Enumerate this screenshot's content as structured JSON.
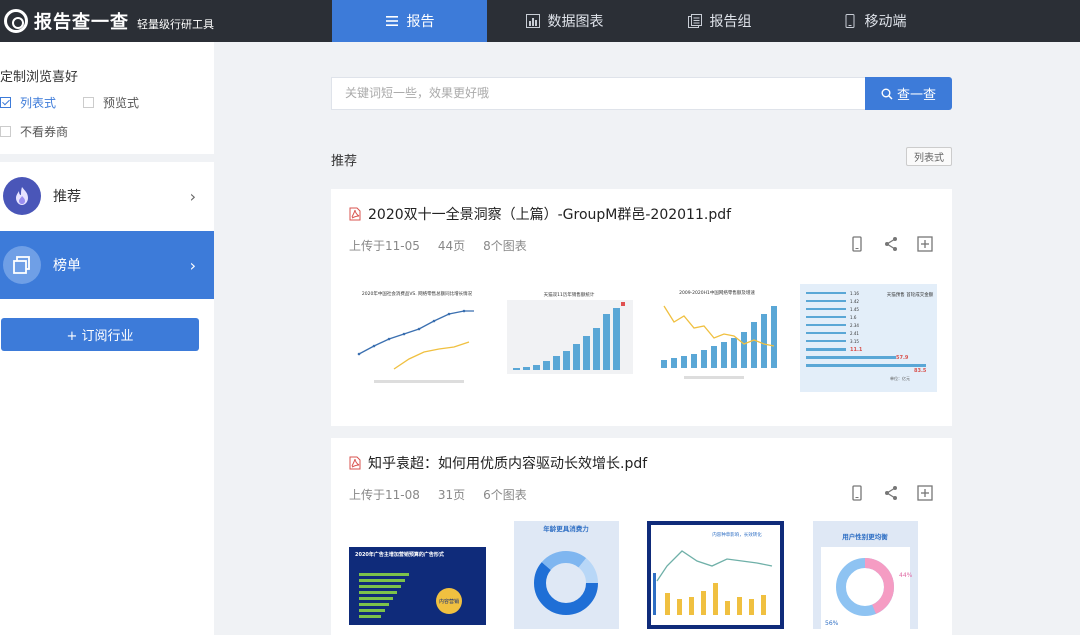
{
  "app": {
    "name": "报告查一查",
    "tagline": "轻量级行研工具"
  },
  "nav": {
    "tabs": [
      {
        "label": "报告",
        "icon": "list-icon",
        "active": true
      },
      {
        "label": "数据图表",
        "icon": "chart-icon",
        "active": false
      },
      {
        "label": "报告组",
        "icon": "folder-icon",
        "active": false
      },
      {
        "label": "移动端",
        "icon": "phone-icon",
        "active": false
      }
    ]
  },
  "sidebar": {
    "pref_title": "定制浏览喜好",
    "options": [
      {
        "label": "列表式",
        "checked": true
      },
      {
        "label": "预览式",
        "checked": false
      },
      {
        "label": "不看券商",
        "checked": false
      }
    ],
    "items": [
      {
        "label": "推荐",
        "icon": "flame-icon",
        "active": false
      },
      {
        "label": "榜单",
        "icon": "layers-icon",
        "active": true
      }
    ],
    "subscribe_label": "+ 订阅行业"
  },
  "search": {
    "placeholder": "关键词短一些，效果更好哦",
    "button": "查一查"
  },
  "section": {
    "title": "推荐",
    "view_toggle": "列表式"
  },
  "reports": [
    {
      "title": "2020双十一全景洞察（上篇）-GroupM群邑-202011.pdf",
      "uploaded": "上传于11-05",
      "pages": "44页",
      "charts": "8个图表",
      "thumbs": [
        {
          "title": "2020年中国社会消费品VS. 网络零售总额同比增长情况"
        },
        {
          "title": "天猫双11历年销售额统计"
        },
        {
          "title": "2009-2020H1中国网络零售额及增速"
        },
        {
          "title": "天猫预售 首轮成交金额",
          "values": [
            "1.16",
            "1.42",
            "1.45",
            "1.6",
            "2.34",
            "2.41",
            "3.15",
            "11.1",
            "57.9",
            "83.5"
          ],
          "unit": "单位：亿元"
        }
      ]
    },
    {
      "title": "知乎袁超：如何用优质内容驱动长效增长.pdf",
      "uploaded": "上传于11-08",
      "pages": "31页",
      "charts": "6个图表",
      "thumbs": [
        {
          "title": "2020年广告主增加营销预算的广告形式",
          "badge": "内容营销"
        },
        {
          "title": "年龄更具消费力"
        },
        {
          "title": "内容种草影响，长效转化"
        },
        {
          "title": "用户性别更均衡",
          "values": [
            "44%",
            "56%"
          ]
        }
      ]
    }
  ],
  "colors": {
    "accent": "#3d7bd9",
    "topbar": "#2b2f36"
  }
}
